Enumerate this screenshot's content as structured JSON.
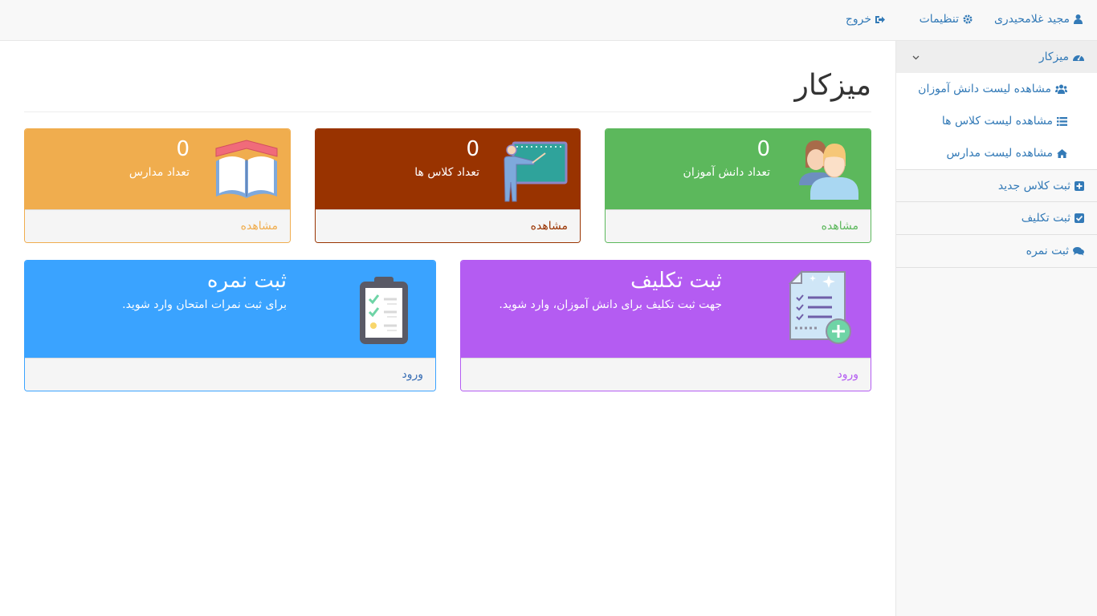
{
  "topbar": {
    "user_label": "مجید غلامحیدری",
    "settings_label": "تنظیمات",
    "logout_label": "خروج"
  },
  "sidebar": {
    "dashboard_label": "میزکار",
    "sub_items": [
      {
        "label": "مشاهده لیست دانش آموزان",
        "icon": "users-icon"
      },
      {
        "label": "مشاهده لیست کلاس ها",
        "icon": "list-icon"
      },
      {
        "label": "مشاهده لیست مدارس",
        "icon": "home-icon"
      }
    ],
    "items": [
      {
        "label": "ثبت کلاس جدید",
        "icon": "plus-square-icon"
      },
      {
        "label": "ثبت تکلیف",
        "icon": "check-square-icon"
      },
      {
        "label": "ثبت نمره",
        "icon": "comments-icon"
      }
    ]
  },
  "main": {
    "title": "میزکار",
    "stats": [
      {
        "value": "0",
        "label": "تعداد دانش آموزان",
        "footer": "مشاهده",
        "color": "#5cb85c"
      },
      {
        "value": "0",
        "label": "تعداد کلاس ها",
        "footer": "مشاهده",
        "color": "#993300"
      },
      {
        "value": "0",
        "label": "تعداد مدارس",
        "footer": "مشاهده",
        "color": "#f0ad4e"
      }
    ],
    "actions": [
      {
        "title": "ثبت تکلیف",
        "subtitle": "جهت ثبت تکلیف برای دانش آموزان، وارد شوید.",
        "footer": "ورود",
        "color": "#b45cf2"
      },
      {
        "title": "ثبت نمره",
        "subtitle": "برای ثبت نمرات امتحان وارد شوید.",
        "footer": "ورود",
        "color": "#3aa3ff"
      }
    ]
  }
}
